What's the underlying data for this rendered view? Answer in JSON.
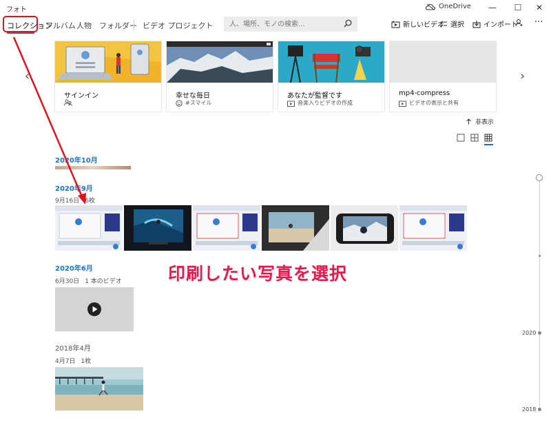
{
  "window": {
    "title": "フォト",
    "onedrive_label": "OneDrive",
    "minimize_label": "—",
    "maximize_label": "☐",
    "close_label": "✕"
  },
  "nav": {
    "tabs": [
      {
        "label": "コレクション",
        "active": true
      },
      {
        "label": "アルバム"
      },
      {
        "label": "人物"
      },
      {
        "label": "フォルダー"
      },
      {
        "label": "ビデオ プロジェクト"
      }
    ],
    "search_placeholder": "人、場所、モノの検索...",
    "tools": {
      "new_video": "新しいビデオ",
      "select": "選択",
      "import": "インポート",
      "more": "···"
    }
  },
  "cards": [
    {
      "title": "サインイン",
      "subtitle": "",
      "icon": "people-icon"
    },
    {
      "title": "幸せな毎日",
      "subtitle": "#スマイル",
      "icon": "smile-icon"
    },
    {
      "title": "あなたが監督です",
      "subtitle": "音楽入りビデオの作成",
      "icon": "video-project-icon"
    },
    {
      "title": "mp4-compress",
      "subtitle": "ビデオの表示と共有",
      "icon": "video-project-icon"
    }
  ],
  "hide_label": "非表示",
  "groups": {
    "oct2020": {
      "heading": "2020年10月"
    },
    "sep2020": {
      "heading": "2020年9月",
      "date": "9月16日",
      "count": "6枚"
    },
    "jun2020": {
      "heading": "2020年6月",
      "date": "6月30日",
      "count": "1 本のビデオ"
    },
    "apr2018": {
      "heading": "2018年4月",
      "date": "4月7日",
      "count": "1枚"
    }
  },
  "annotation": {
    "text": "印刷したい写真を選択",
    "color": "#f0144a"
  },
  "timeline": {
    "labels": [
      "2020",
      "2018"
    ]
  },
  "colors": {
    "accent": "#1a73c8",
    "annotation_red": "#e0121c"
  }
}
